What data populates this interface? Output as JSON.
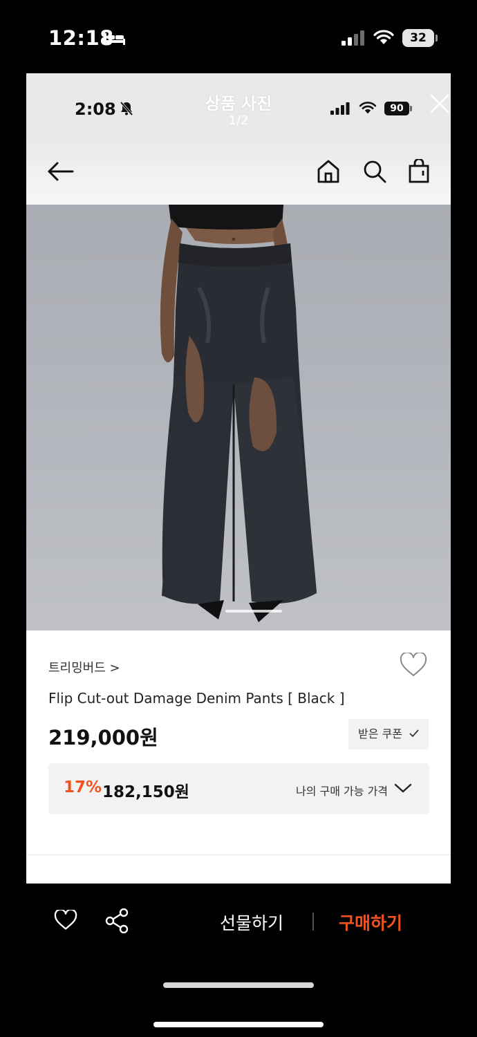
{
  "outer_status": {
    "time": "12:18",
    "battery": "32"
  },
  "inner_status": {
    "time": "2:08",
    "battery": "90"
  },
  "viewer": {
    "title": "상품 사진",
    "counter": "1/2"
  },
  "product": {
    "brand": "트리밍버드 >",
    "name": "Flip Cut-out Damage Denim Pants [ Black ]",
    "price": "219,000원",
    "coupon_label": "받은 쿠폰",
    "discount_rate": "17%",
    "discount_price": "182,150원",
    "my_price_label": "나의 구매 가능 가격"
  },
  "bottom_bar": {
    "gift_label": "선물하기",
    "buy_label": "구매하기"
  },
  "colors": {
    "accent": "#f1521f",
    "panel": "#ffffff",
    "background": "#000000"
  }
}
